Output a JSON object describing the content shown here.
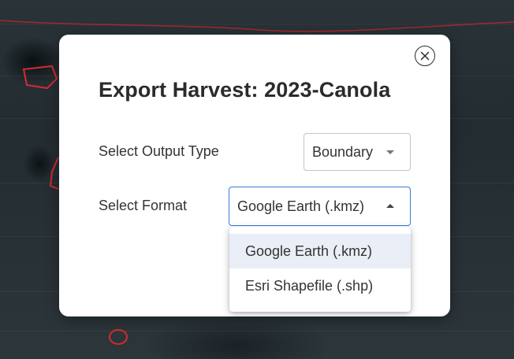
{
  "dialog": {
    "title": "Export Harvest: 2023-Canola",
    "close_icon": "close-circle-icon"
  },
  "output_type": {
    "label": "Select Output Type",
    "selected": "Boundary",
    "icon": "caret-down-icon"
  },
  "format": {
    "label": "Select Format",
    "selected": "Google Earth (.kmz)",
    "icon": "caret-up-icon",
    "options": [
      {
        "label": "Google Earth (.kmz)",
        "selected": true
      },
      {
        "label": "Esri Shapefile (.shp)",
        "selected": false
      }
    ]
  },
  "colors": {
    "focus_border": "#3a7bd5",
    "selected_option_bg": "#e9eef7",
    "boundary_line": "#c0282d"
  }
}
